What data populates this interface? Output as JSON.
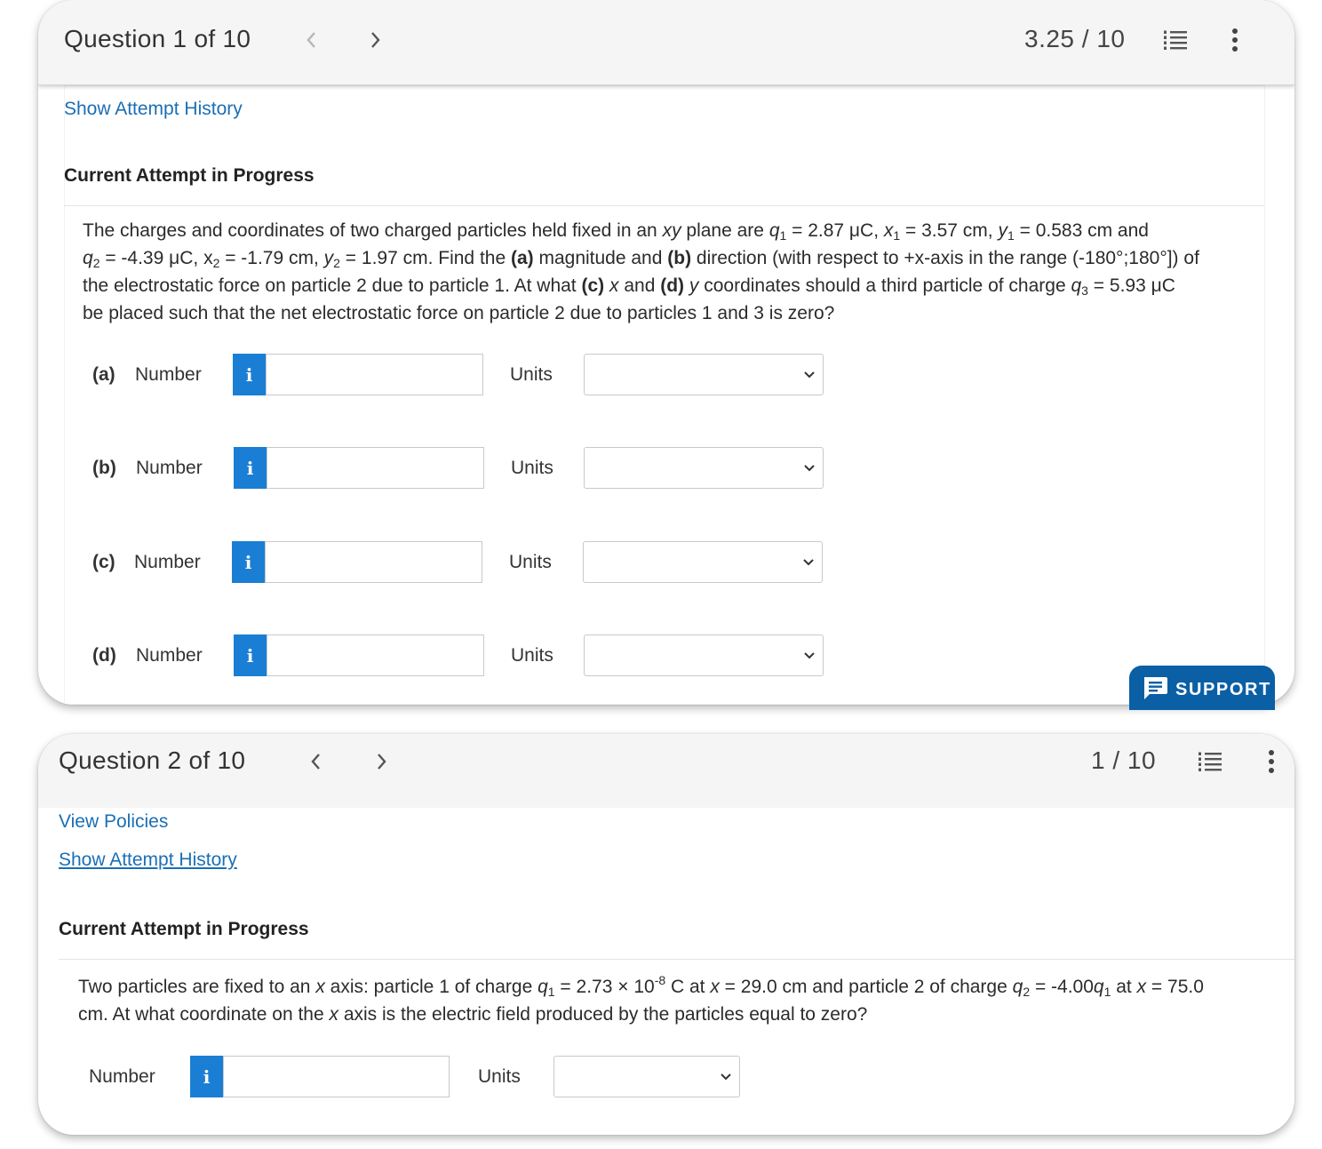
{
  "question1": {
    "title": "Question 1 of 10",
    "score": "3.25 / 10",
    "show_attempt_history": "Show Attempt History",
    "current_attempt": "Current Attempt in Progress",
    "text": {
      "l1a": "The charges and coordinates of two charged particles held fixed in an ",
      "xy": "xy",
      "l1b": " plane are ",
      "q": "q",
      "sub1": "1",
      "sub2": "2",
      "sub3": "3",
      "x": "x",
      "y": "y",
      "eq_q1": " = 2.87 μC, ",
      "eq_x1": " = 3.57 cm, ",
      "eq_y1": " = 0.583 cm and",
      "eq_q2": " = -4.39 μC, ",
      "x2_plain": "x",
      "eq_x2": " = -1.79 cm, ",
      "eq_y2": " = 1.97 cm. Find the ",
      "a": "(a)",
      "magnitude_and": " magnitude and ",
      "b": "(b)",
      "direction_text": " direction (with respect to +x-axis in the range (-180°;180°]) of",
      "l3a": "the electrostatic force on particle 2 due to particle 1. At what ",
      "c": "(c)",
      "space_x_and": " and ",
      "d": "(d)",
      "coords_text": " coordinates should a third particle of charge ",
      "eq_q3": " = 5.93 μC",
      "l4": "be placed such that the net electrostatic force on particle 2 due to particles 1 and 3 is zero?"
    },
    "parts": [
      {
        "label": "(a)",
        "number_label": "Number",
        "info": "i",
        "value": "",
        "units_label": "Units",
        "units_value": ""
      },
      {
        "label": "(b)",
        "number_label": "Number",
        "info": "i",
        "value": "",
        "units_label": "Units",
        "units_value": ""
      },
      {
        "label": "(c)",
        "number_label": "Number",
        "info": "i",
        "value": "",
        "units_label": "Units",
        "units_value": ""
      },
      {
        "label": "(d)",
        "number_label": "Number",
        "info": "i",
        "value": "",
        "units_label": "Units",
        "units_value": ""
      }
    ]
  },
  "question2": {
    "title": "Question 2 of 10",
    "score": "1 / 10",
    "view_policies": "View Policies",
    "show_attempt_history": "Show Attempt History",
    "current_attempt": "Current Attempt in Progress",
    "text": {
      "l1a": "Two particles are fixed to an ",
      "x": "x",
      "l1b": " axis: particle 1 of charge ",
      "q": "q",
      "sub1": "1",
      "sub2": "2",
      "eq_q1": " = 2.73 × 10",
      "exp": "-8",
      "c_at": " C at ",
      "eq_x1": " = 29.0 cm and particle 2 of charge ",
      "eq_q2": " = -4.00",
      "at": " at ",
      "eq_x2": " = 75.0",
      "l2a": "cm. At what coordinate on the ",
      "l2b": " axis is the electric field produced by the particles equal to zero?"
    },
    "part": {
      "number_label": "Number",
      "info": "i",
      "value": "",
      "units_label": "Units",
      "units_value": ""
    }
  },
  "support_button": "SUPPORT",
  "colors": {
    "link": "#1a6fb5",
    "info_button": "#1a7fd4",
    "support_button": "#0b5fa5",
    "header_bg": "#f5f5f5"
  },
  "icons": [
    "chevron-left-icon",
    "chevron-right-icon",
    "list-icon",
    "more-vert-icon",
    "info-icon",
    "chevron-down-icon",
    "chat-icon"
  ]
}
